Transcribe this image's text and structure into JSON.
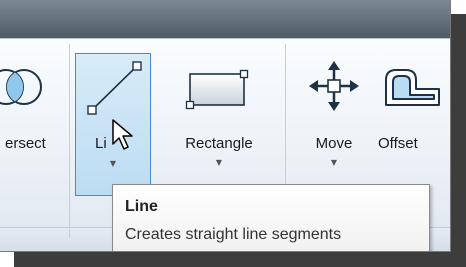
{
  "ribbon": {
    "buttons": [
      {
        "id": "intersect",
        "label": "ersect",
        "icon": "intersect-icon"
      },
      {
        "id": "line",
        "label": "Li",
        "icon": "line-icon",
        "state": "hover"
      },
      {
        "id": "rectangle",
        "label": "Rectangle",
        "icon": "rectangle-icon"
      },
      {
        "id": "move",
        "label": "Move",
        "icon": "move-icon"
      },
      {
        "id": "offset",
        "label": "Offset",
        "icon": "offset-icon"
      }
    ]
  },
  "tooltip": {
    "title": "Line",
    "description": "Creates straight line segments"
  },
  "colors": {
    "titlebar": "#5a6670",
    "ribbon_bg": "#eef3f8",
    "hover_fill": "#c8e3f5",
    "hover_border": "#3e8fd0",
    "icon_stroke": "#1d3244",
    "frame_shadow": "#3d3d3d"
  }
}
